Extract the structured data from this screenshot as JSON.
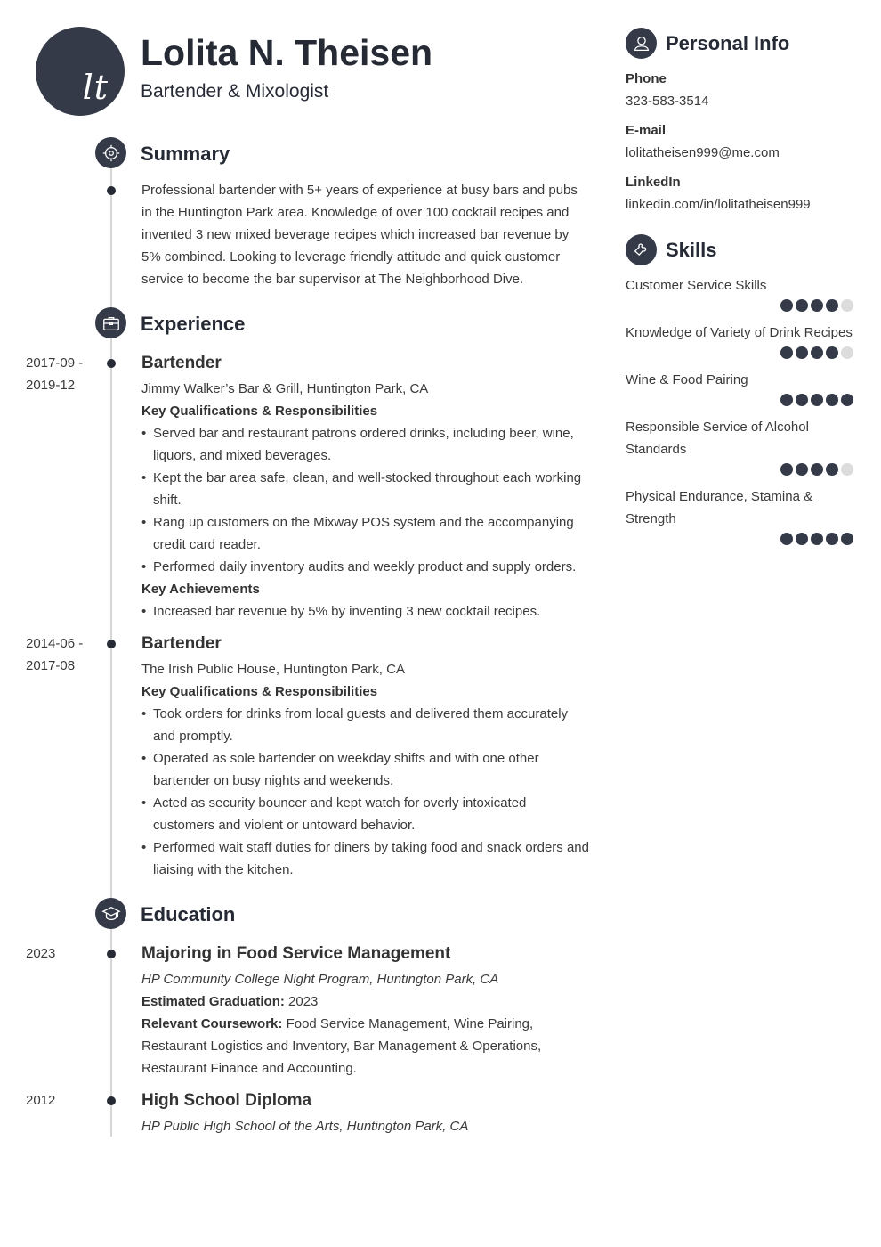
{
  "header": {
    "initials": "lt",
    "name": "Lolita N. Theisen",
    "role": "Bartender & Mixologist"
  },
  "colors": {
    "accent": "#343a48",
    "text": "#3a3a3a",
    "timeline": "#d6d6d6",
    "dot_off": "#dcdcdc"
  },
  "summary": {
    "title": "Summary",
    "icon": "target-icon",
    "text": "Professional bartender with 5+ years of experience at busy bars and pubs in the Huntington Park area. Knowledge of over 100 cocktail recipes and invented 3 new mixed beverage recipes which increased bar revenue by 5% combined. Looking to leverage friendly attitude and quick customer service to become the bar supervisor at The Neighborhood Dive."
  },
  "experience": {
    "title": "Experience",
    "icon": "briefcase-icon",
    "jobs": [
      {
        "date_start": "2017-09 -",
        "date_end": "2019-12",
        "title": "Bartender",
        "company": "Jimmy Walker’s Bar & Grill, Huntington Park, CA",
        "resp_heading": "Key Qualifications & Responsibilities",
        "responsibilities": [
          "Served bar and restaurant patrons ordered drinks, including beer, wine, liquors, and mixed beverages.",
          "Kept the bar area safe, clean, and well-stocked throughout each working shift.",
          "Rang up customers on the Mixway POS system and the accompanying credit card reader.",
          "Performed daily inventory audits and weekly product and supply orders."
        ],
        "ach_heading": "Key Achievements",
        "achievements": [
          "Increased bar revenue by 5% by inventing 3 new cocktail recipes."
        ]
      },
      {
        "date_start": "2014-06 -",
        "date_end": "2017-08",
        "title": "Bartender",
        "company": "The Irish Public House, Huntington Park, CA",
        "resp_heading": "Key Qualifications & Responsibilities",
        "responsibilities": [
          "Took orders for drinks from local guests and delivered them accurately and promptly.",
          "Operated as sole bartender on weekday shifts and with one other bartender on busy nights and weekends.",
          "Acted as security bouncer and kept watch for overly intoxicated customers and violent or untoward behavior.",
          "Performed wait staff duties for diners by taking food and snack orders and liaising with the kitchen."
        ]
      }
    ]
  },
  "education": {
    "title": "Education",
    "icon": "graduation-cap-icon",
    "items": [
      {
        "date": "2023",
        "degree": "Majoring in Food Service Management",
        "school": "HP Community College Night Program, Huntington Park, CA",
        "grad_label": "Estimated Graduation:",
        "grad_value": "2023",
        "coursework_label": "Relevant Coursework:",
        "coursework_value": "Food Service Management, Wine Pairing, Restaurant Logistics and Inventory, Bar Management & Operations, Restaurant Finance and Accounting."
      },
      {
        "date": "2012",
        "degree": "High School Diploma",
        "school": "HP Public High School of the Arts, Huntington Park, CA"
      }
    ]
  },
  "personal_info": {
    "title": "Personal Info",
    "icon": "user-icon",
    "fields": [
      {
        "label": "Phone",
        "value": "323-583-3514"
      },
      {
        "label": "E-mail",
        "value": "lolitatheisen999@me.com"
      },
      {
        "label": "LinkedIn",
        "value": "linkedin.com/in/lolitatheisen999"
      }
    ]
  },
  "skills": {
    "title": "Skills",
    "icon": "puzzle-icon",
    "max_level": 5,
    "items": [
      {
        "name": "Customer Service Skills",
        "level": 4
      },
      {
        "name": "Knowledge of Variety of Drink Recipes",
        "level": 4
      },
      {
        "name": "Wine & Food Pairing",
        "level": 5
      },
      {
        "name": "Responsible Service of Alcohol Standards",
        "level": 4
      },
      {
        "name": "Physical Endurance, Stamina & Strength",
        "level": 5
      }
    ]
  }
}
